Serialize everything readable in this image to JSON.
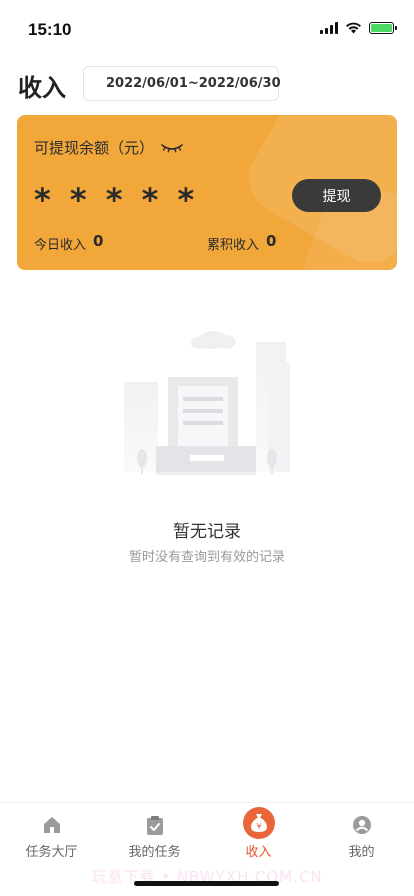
{
  "status": {
    "time": "15:10"
  },
  "header": {
    "title": "收入",
    "date_range": "2022/06/01~2022/06/30"
  },
  "balance": {
    "label": "可提现余额（元）",
    "masked_value": "* * * * *",
    "withdraw_label": "提现",
    "today_label": "今日收入",
    "today_value": "0",
    "total_label": "累积收入",
    "total_value": "0"
  },
  "empty": {
    "title": "暂无记录",
    "subtitle": "暂时没有查询到有效的记录"
  },
  "tabs": [
    {
      "label": "任务大厅",
      "icon": "home-icon",
      "active": false
    },
    {
      "label": "我的任务",
      "icon": "task-clipboard-icon",
      "active": false
    },
    {
      "label": "收入",
      "icon": "money-bag-icon",
      "active": true
    },
    {
      "label": "我的",
      "icon": "profile-icon",
      "active": false
    }
  ],
  "watermark": "玩意下载 • NBWYXH.COM.CN",
  "colors": {
    "card": "#f2a73b",
    "accent": "#e8663a",
    "button": "#3a3a3a"
  }
}
